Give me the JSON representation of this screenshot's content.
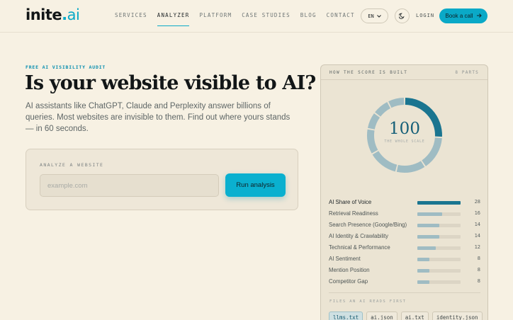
{
  "brand": {
    "name_main": "inite",
    "name_dot": ".",
    "name_suffix": "ai"
  },
  "nav": {
    "links": [
      "SERVICES",
      "ANALYZER",
      "PLATFORM",
      "CASE STUDIES",
      "BLOG",
      "CONTACT"
    ],
    "active": "ANALYZER",
    "language": "EN",
    "login": "LOGIN",
    "cta": "Book a call"
  },
  "hero": {
    "eyebrow": "FREE AI VISIBILITY AUDIT",
    "headline": "Is your website visible to AI?",
    "subtitle": "AI assistants like ChatGPT, Claude and Perplexity answer billions of queries. Most websites are invisible to them. Find out where yours stands — in 60 seconds."
  },
  "analyzer": {
    "label": "ANALYZE A WEBSITE",
    "placeholder": "example.com",
    "button": "Run analysis"
  },
  "score_panel": {
    "title": "HOW THE SCORE IS BUILT",
    "parts_label": "8 PARTS",
    "total": "100",
    "caption": "THE WHOLE SCALE",
    "accent_color": "#1a7590",
    "muted_color": "#9fbcc3",
    "items": [
      {
        "label": "AI Share of Voice",
        "value": 28
      },
      {
        "label": "Retrieval Readiness",
        "value": 16
      },
      {
        "label": "Search Presence (Google/Bing)",
        "value": 14
      },
      {
        "label": "AI Identity & Crawlability",
        "value": 14
      },
      {
        "label": "Technical & Performance",
        "value": 12
      },
      {
        "label": "AI Sentiment",
        "value": 8
      },
      {
        "label": "Mention Position",
        "value": 8
      },
      {
        "label": "Competitor Gap",
        "value": 8
      }
    ],
    "files_label": "FILES AN AI READS FIRST",
    "files": [
      "llms.txt",
      "ai.json",
      "ai.txt",
      "identity.json"
    ]
  },
  "colors": {
    "brand": "#0aa9c7",
    "background": "#f7f1e3"
  }
}
